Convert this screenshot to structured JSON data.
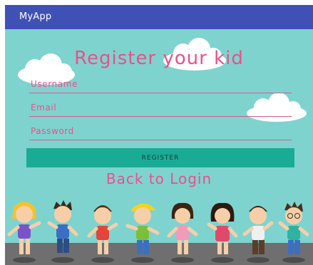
{
  "app_bar": {
    "title": "MyApp"
  },
  "form": {
    "title": "Register your kid",
    "username_label": "Username",
    "email_label": "Email",
    "password_label": "Password",
    "register_label": "REGISTER",
    "back_label": "Back to Login"
  },
  "colors": {
    "app_bar": "#3f51b5",
    "background": "#7ed3cf",
    "accent_pink": "#e8518c",
    "button": "#1aab95",
    "ground": "#6f6f6f"
  },
  "illustration": {
    "description_icons": [
      "cloud-icon",
      "kid-illustration"
    ]
  }
}
